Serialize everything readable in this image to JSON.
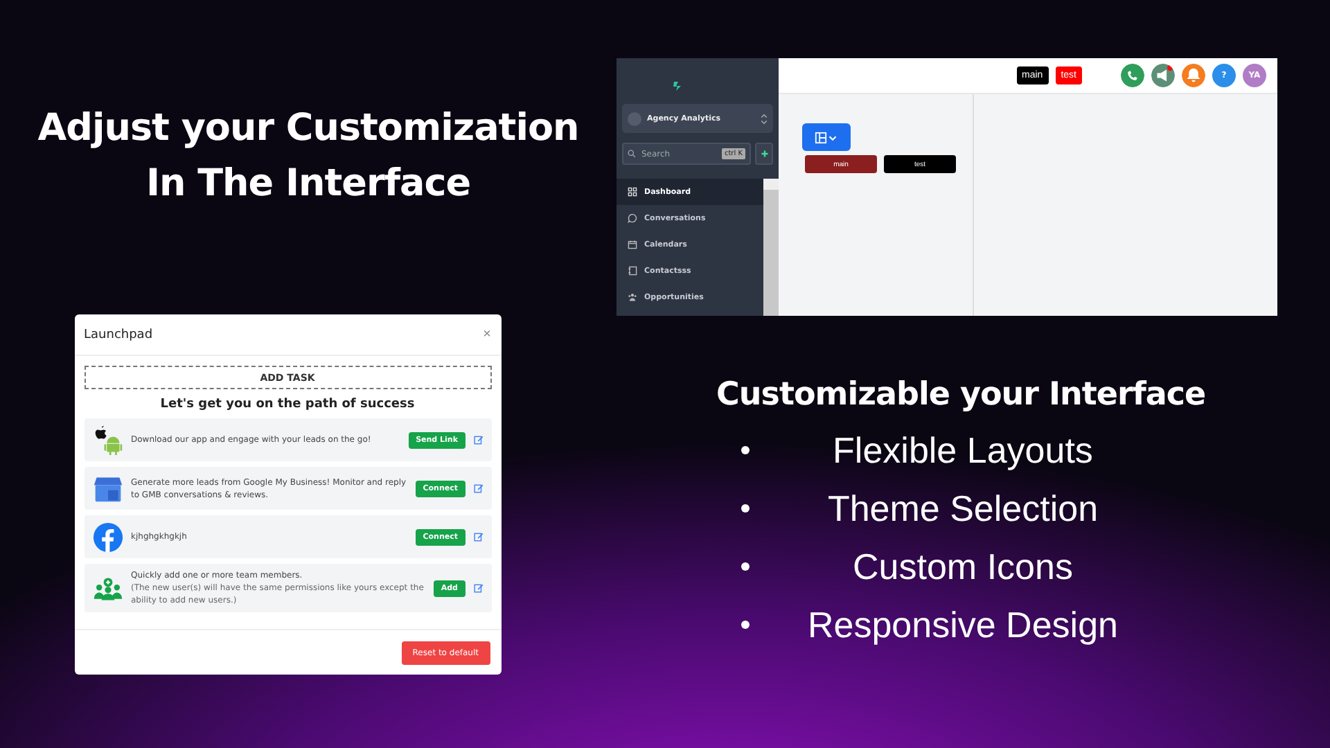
{
  "headline": [
    "Adjust your Customization",
    "In The Interface"
  ],
  "app": {
    "agency": "Agency Analytics",
    "search": {
      "placeholder": "Search",
      "shortcut": "ctrl K"
    },
    "nav": [
      {
        "label": "Dashboard",
        "kind": "grid",
        "selected": true
      },
      {
        "label": "Conversations",
        "kind": "chat",
        "selected": false
      },
      {
        "label": "Calendars",
        "kind": "calendar",
        "selected": false
      },
      {
        "label": "Contactsss",
        "kind": "contacts",
        "selected": false
      },
      {
        "label": "Opportunities",
        "kind": "people",
        "selected": false
      }
    ],
    "canvas_buttons": [
      {
        "label": "main",
        "color": "#8b1e1e"
      },
      {
        "label": "test",
        "color": "#000000"
      }
    ],
    "top_buttons": [
      {
        "label": "main",
        "color": "#000000"
      },
      {
        "label": "test",
        "color": "#ff0000"
      }
    ],
    "top_icons": [
      {
        "kind": "phone",
        "color": "#2f9e5b"
      },
      {
        "kind": "megaphone",
        "color": "#5d8f77"
      },
      {
        "kind": "bell",
        "color": "#f57c1f"
      },
      {
        "kind": "help",
        "color": "#2b8fea",
        "text": "?"
      },
      {
        "kind": "avatar",
        "color": "#b07cc6",
        "text": "YA"
      }
    ]
  },
  "launchpad": {
    "title": "Launchpad",
    "close": "×",
    "add_task": "ADD TASK",
    "heading": "Let's get you on the path of success",
    "tasks": [
      {
        "kind": "mobile",
        "text": "Download our app and engage with your leads on the go!",
        "action": "Send Link"
      },
      {
        "kind": "gmb",
        "text": "Generate more leads from Google My Business! Monitor and reply to GMB conversations & reviews.",
        "action": "Connect"
      },
      {
        "kind": "facebook",
        "text": "kjhghgkhgkjh",
        "action": "Connect"
      },
      {
        "kind": "team",
        "text": "Quickly add one or more team members.",
        "note": "(The new user(s) will have the same permissions like yours except the ability to add new users.)",
        "action": "Add"
      }
    ],
    "reset": "Reset to default"
  },
  "features": {
    "title": "Customizable your Interface",
    "items": [
      "Flexible Layouts",
      "Theme Selection",
      "Custom Icons",
      "Responsive Design"
    ]
  }
}
